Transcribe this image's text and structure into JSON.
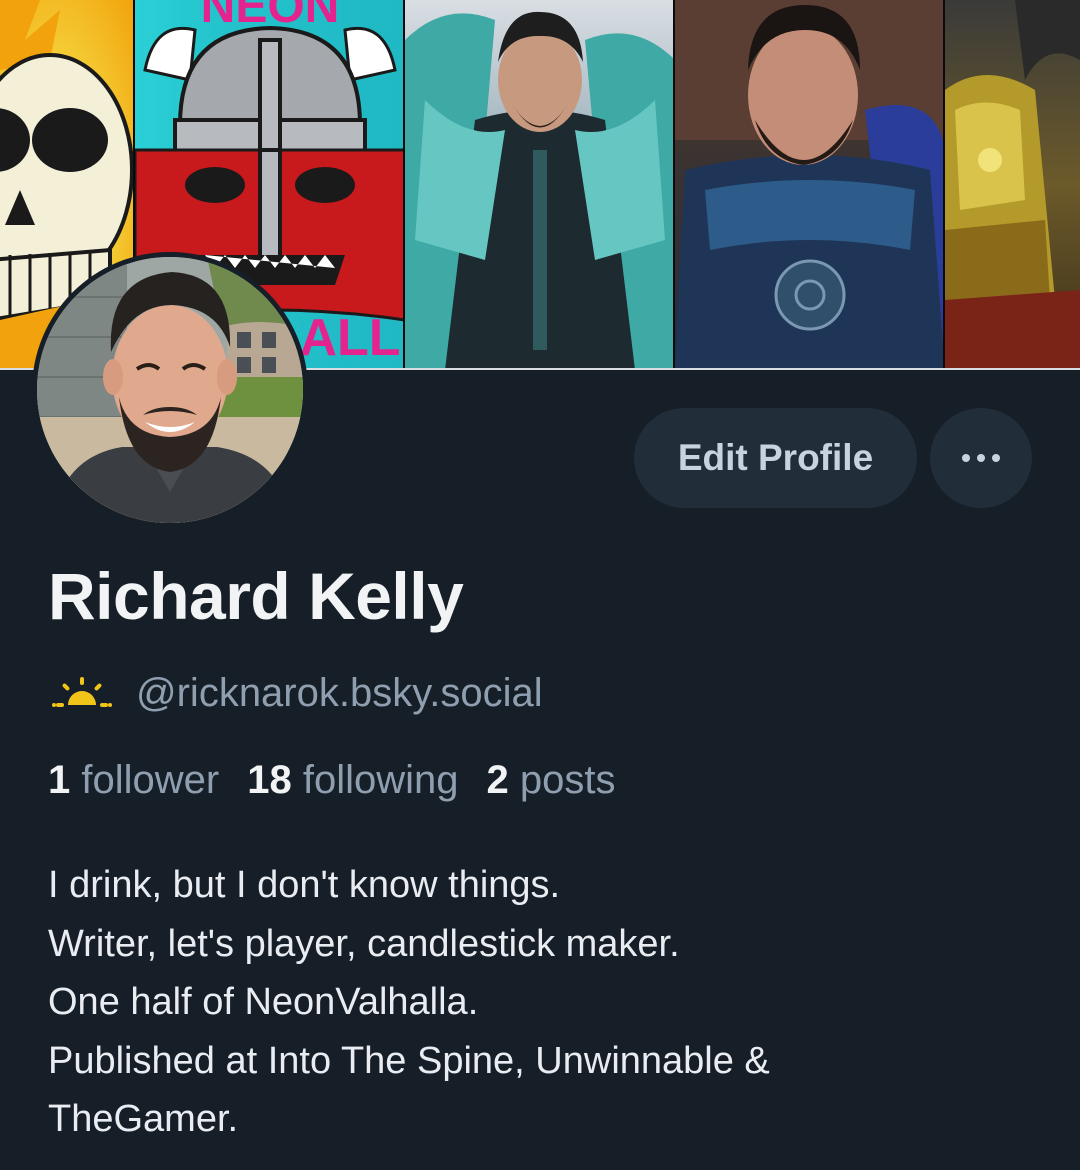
{
  "profile": {
    "display_name": "Richard Kelly",
    "handle": "@ricknarok.bsky.social",
    "handle_icon": "sunrise-icon"
  },
  "banner": {
    "panels": [
      {
        "name": "skull-artwork",
        "color": "#f4d23a"
      },
      {
        "name": "viking-helmet-artwork",
        "color": "#2bd0d6",
        "text": "NEON",
        "text2": "ALL"
      },
      {
        "name": "feathered-cloak-character",
        "color": "#9fb3bd"
      },
      {
        "name": "bearded-man-armor",
        "color": "#1f2d45"
      },
      {
        "name": "golden-armor-character",
        "color": "#6c5a2a"
      }
    ]
  },
  "actions": {
    "edit_label": "Edit Profile",
    "more_icon": "ellipsis-icon"
  },
  "stats": {
    "followers_count": "1",
    "followers_label": "follower",
    "following_count": "18",
    "following_label": "following",
    "posts_count": "2",
    "posts_label": "posts"
  },
  "bio": {
    "lines": [
      "I drink, but I don't know things.",
      "Writer, let's player, candlestick maker.",
      "One half of NeonValhalla.",
      "Published at Into The Spine, Unwinnable &",
      "TheGamer."
    ]
  },
  "colors": {
    "background": "#161e27",
    "button_bg": "#222d3a",
    "muted_text": "#8f9fb0",
    "primary_text": "#f1f3f5",
    "handle_icon": "#f0c419"
  }
}
